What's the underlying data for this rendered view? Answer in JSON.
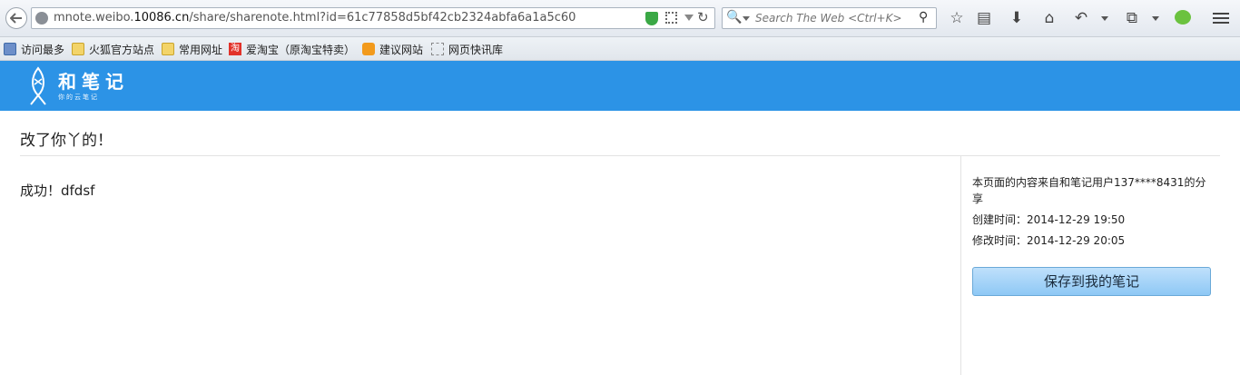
{
  "browser": {
    "url_prefix": "mnote.weibo.",
    "url_domain": "10086.cn",
    "url_path": "/share/sharenote.html?id=61c77858d5bf42cb2324abfa6a1a5c60",
    "search_placeholder": "Search The Web <Ctrl+K>",
    "bookmarks": [
      {
        "label": "访问最多",
        "icon": "page-icon"
      },
      {
        "label": "火狐官方站点",
        "icon": "folder-icon"
      },
      {
        "label": "常用网址",
        "icon": "folder-icon"
      },
      {
        "label": "爱淘宝（原淘宝特卖）",
        "icon": "taobao-icon"
      },
      {
        "label": "建议网站",
        "icon": "bulb-icon"
      },
      {
        "label": "网页快讯库",
        "icon": "dotted-box-icon"
      }
    ],
    "taobao_glyph": "淘"
  },
  "site": {
    "logo_title": "和笔记",
    "logo_subtitle": "你的云笔记"
  },
  "note": {
    "title": "改了你丫的！",
    "body": "成功！dfdsf"
  },
  "sidebar": {
    "source": "本页面的内容来自和笔记用户137****8431的分享",
    "created": "创建时间：2014-12-29 19:50",
    "modified": "修改时间：2014-12-29 20:05",
    "save_label": "保存到我的笔记"
  },
  "colors": {
    "header_bg": "#2c93e6",
    "button_bg": "#9dd0f7"
  }
}
